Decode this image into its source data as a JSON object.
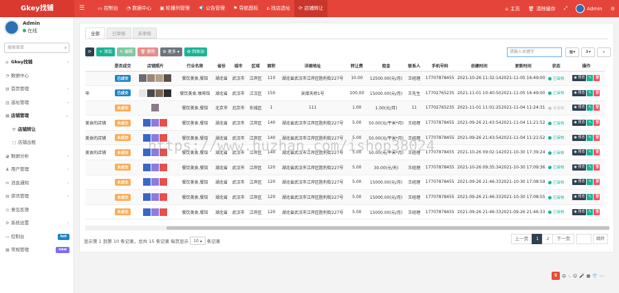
{
  "app": {
    "brand": "Gkey找铺"
  },
  "nav": [
    {
      "icon": "desktop-icon",
      "label": "控制台"
    },
    {
      "icon": "dashboard-icon",
      "label": "数据中心"
    },
    {
      "icon": "image-icon",
      "label": "轮播列管理"
    },
    {
      "icon": "bullhorn-icon",
      "label": "公告管理"
    },
    {
      "icon": "flag-icon",
      "label": "导航图标"
    },
    {
      "icon": "home-icon",
      "label": "找店选址"
    },
    {
      "icon": "refresh-icon",
      "label": "店铺转让"
    }
  ],
  "top_right": {
    "home": "主页",
    "clear": "清除缓存",
    "user": "Admin"
  },
  "profile": {
    "name": "Admin",
    "status": "在线"
  },
  "sidebar_search": "搜索菜单",
  "menu": [
    {
      "label": "Gkey找铺",
      "type": "main",
      "arrow": "‹"
    },
    {
      "label": "数据中心",
      "type": "item",
      "arrow": ""
    },
    {
      "label": "首页管理",
      "type": "item",
      "arrow": "‹"
    },
    {
      "label": "选址管理",
      "type": "item",
      "arrow": "‹"
    },
    {
      "label": "店铺管理",
      "type": "open",
      "arrow": "⌄"
    },
    {
      "label": "店铺转让",
      "type": "sel",
      "arrow": ""
    },
    {
      "label": "店铺出租",
      "type": "subitem",
      "arrow": ""
    },
    {
      "label": "数据分析",
      "type": "item",
      "arrow": "‹"
    },
    {
      "label": "用户管理",
      "type": "item",
      "arrow": "‹"
    },
    {
      "label": "消息通知",
      "type": "item",
      "arrow": "‹"
    },
    {
      "label": "资讯管理",
      "type": "item",
      "arrow": "‹"
    },
    {
      "label": "意见反馈",
      "type": "item",
      "arrow": ""
    },
    {
      "label": "系统设置",
      "type": "item",
      "arrow": "‹"
    },
    {
      "label": "控制台",
      "type": "item",
      "arrow": "",
      "badge": "hot",
      "badge_color": "#1c84c6"
    },
    {
      "label": "常规管理",
      "type": "item",
      "arrow": "",
      "badge": "new",
      "badge_color": "#7a6ff0"
    }
  ],
  "tabs": [
    "全部",
    "已审核",
    "未审核"
  ],
  "toolbar": {
    "refresh": "⟳",
    "add": "添加",
    "edit": "编辑",
    "delete": "删除",
    "more": "更多",
    "recycle": "回收站"
  },
  "search_placeholder": "请输入关键字",
  "columns": [
    "",
    "是否成交",
    "店铺照片",
    "行业名称",
    "省份",
    "城市",
    "区域",
    "面积",
    "详细地址",
    "转让费",
    "租金",
    "联系人",
    "手机号码",
    "创建时间",
    "更新时间",
    "状态",
    "操作"
  ],
  "rows": [
    {
      "title": "",
      "deal": "已成交",
      "deal_type": "done",
      "photos": [
        "#6b6b6b",
        "#9a8774",
        "#b4a087",
        "#5a5148"
      ],
      "industry": "餐饮美食,餐馆",
      "province": "湖北省",
      "city": "武汉市",
      "district": "江岸区",
      "area": "110",
      "address": "湖北省武汉市江岸区胜利街227号",
      "fee": "10.00",
      "rent": "12500.00(元/月)",
      "contact": "王经理",
      "phone": "17707878455",
      "created": "2021-10-26 11:32:14",
      "updated": "2021-11-05 16:49:00",
      "status": "已审核",
      "status_on": true
    },
    {
      "title": "业申",
      "deal": "已成交",
      "deal_type": "done",
      "photos": [
        "#e6e6e6",
        "#4a4a4a",
        "#7b6a58",
        "#2e2e2e"
      ],
      "industry": "餐饮美食,咖啡馆",
      "province": "湖北省",
      "city": "武汉市",
      "district": "江汉区",
      "area": "150",
      "address": "吴缘天桥1号",
      "fee": "100.00",
      "rent": "15000.00(元/月)",
      "contact": "王先生",
      "phone": "17702765235",
      "created": "2021-11-01 10:40:50",
      "updated": "2021-11-05 16:49:00",
      "status": "已审核",
      "status_on": true
    },
    {
      "title": "",
      "deal": "未成交",
      "deal_type": "no",
      "photos": [
        "#8a7a8a"
      ],
      "industry": "餐饮美食,餐馆",
      "province": "北京市",
      "city": "北京市",
      "district": "东城区",
      "area": "1",
      "address": "111",
      "fee": "1.00",
      "rent": "1.00(元/月)",
      "contact": "11",
      "phone": "17702765235",
      "created": "2021-11-01 11:01:25",
      "updated": "2021-11-04 11:24:31",
      "status": "未审核",
      "status_on": false
    },
    {
      "title": "饮美食的店铺",
      "deal": "未成交",
      "deal_type": "no",
      "photos": [
        "#3a66c8",
        "#8f7ae0",
        "#e8504a"
      ],
      "industry": "餐饮美食,餐馆",
      "province": "湖北省",
      "city": "武汉市",
      "district": "江岸区",
      "area": "140",
      "address": "湖北省武汉市江岸区胜利街227号",
      "fee": "5.00",
      "rent": "50.00(元/平米*月)",
      "contact": "王经理",
      "phone": "17707878455",
      "created": "2021-09-26 21:43:54",
      "updated": "2021-11-04 11:21:52",
      "status": "已审核",
      "status_on": true
    },
    {
      "title": "饮美食的店铺",
      "deal": "未成交",
      "deal_type": "no",
      "photos": [
        "#3a66c8",
        "#8f7ae0",
        "#e8504a"
      ],
      "industry": "餐饮美食,餐馆",
      "province": "湖北省",
      "city": "武汉市",
      "district": "江岸区",
      "area": "140",
      "address": "湖北省武汉市江岸区胜利街227号",
      "fee": "5.00",
      "rent": "50.00(元/平米*月)",
      "contact": "王经理",
      "phone": "17707878455",
      "created": "2021-09-26 21:43:54",
      "updated": "2021-11-04 11:21:52",
      "status": "已审核",
      "status_on": true
    },
    {
      "title": "饮美食的店铺",
      "deal": "未成交",
      "deal_type": "no",
      "photos": [
        "#3a66c8",
        "#8f7ae0",
        "#e8504a"
      ],
      "industry": "餐饮美食,餐馆",
      "province": "湖北省",
      "city": "武汉市",
      "district": "江岸区",
      "area": "140",
      "address": "湖北省武汉市江岸区胜利街227号",
      "fee": "5.00",
      "rent": "50.00(元/平米*月)",
      "contact": "王经理",
      "phone": "17707878455",
      "created": "2021-10-26 09:02:14",
      "updated": "2021-10-30 17:39:24",
      "status": "已审核",
      "status_on": true
    },
    {
      "title": "",
      "deal": "未成交",
      "deal_type": "no",
      "photos": [
        "#3a66c8",
        "#8f7ae0",
        "#e8504a"
      ],
      "industry": "餐饮美食,餐馆",
      "province": "湖北省",
      "city": "武汉市",
      "district": "江岸区",
      "area": "120",
      "address": "湖北省武汉市江岸区胜利街227号",
      "fee": "5.00",
      "rent": "30.00(元/天)",
      "contact": "王经理",
      "phone": "17707878455",
      "created": "2021-10-26 09:35:34",
      "updated": "2021-10-30 17:09:36",
      "status": "已审核",
      "status_on": true
    },
    {
      "title": "",
      "deal": "未成交",
      "deal_type": "no",
      "photos": [
        "#3a66c8",
        "#8f7ae0",
        "#e8504a"
      ],
      "industry": "餐饮美食,餐馆",
      "province": "湖北省",
      "city": "武汉市",
      "district": "江岸区",
      "area": "120",
      "address": "湖北省武汉市江岸区胜利街227号",
      "fee": "5.00",
      "rent": "15000.00(元/月)",
      "contact": "王经理",
      "phone": "17707878455",
      "created": "2021-09-26 21:46:33",
      "updated": "2021-10-30 17:08:59",
      "status": "已审核",
      "status_on": true
    },
    {
      "title": "",
      "deal": "未成交",
      "deal_type": "no",
      "photos": [
        "#3a66c8",
        "#8f7ae0",
        "#e8504a"
      ],
      "industry": "餐饮美食,餐馆",
      "province": "湖北省",
      "city": "武汉市",
      "district": "江岸区",
      "area": "120",
      "address": "湖北省武汉市江岸区胜利街227号",
      "fee": "5.00",
      "rent": "15000.00(元/月)",
      "contact": "王经理",
      "phone": "17707878455",
      "created": "2021-09-26 21:46:33",
      "updated": "2021-10-30 17:08:55",
      "status": "已审核",
      "status_on": true
    },
    {
      "title": "",
      "deal": "未成交",
      "deal_type": "no",
      "photos": [
        "#3a66c8",
        "#8f7ae0",
        "#e8504a"
      ],
      "industry": "餐饮美食,餐馆",
      "province": "湖北省",
      "city": "武汉市",
      "district": "江岸区",
      "area": "120",
      "address": "湖北省武汉市江岸区胜利街227号",
      "fee": "5.00",
      "rent": "15000.00(元/月)",
      "contact": "王经理",
      "phone": "17707878455",
      "created": "2021-09-26 21:46:33",
      "updated": "2021-09-26 21:46:33",
      "status": "已审核",
      "status_on": true
    }
  ],
  "row_ops": {
    "view": "预览",
    "edit": "✎",
    "delete": "🗑"
  },
  "pagination": {
    "info_prefix": "显示第 1 到第 10 条记录，总共 15 条记录 每页显示",
    "per_page": "10",
    "info_suffix": "条记录",
    "prev": "上一页",
    "pages": [
      "1",
      "2"
    ],
    "current": "1",
    "next": "下一页",
    "jump": "跳转"
  },
  "watermark": "https://www.huzhan.com/ishop38024",
  "ime": {
    "logo": "S",
    "items": [
      "中",
      "·,",
      "☺",
      "🎤",
      "▦",
      "👕",
      "⋯"
    ]
  },
  "colors": {
    "topbar": "#e5443a",
    "accent": "#1ab394",
    "dark": "#2f4050",
    "danger": "#ed5565"
  }
}
